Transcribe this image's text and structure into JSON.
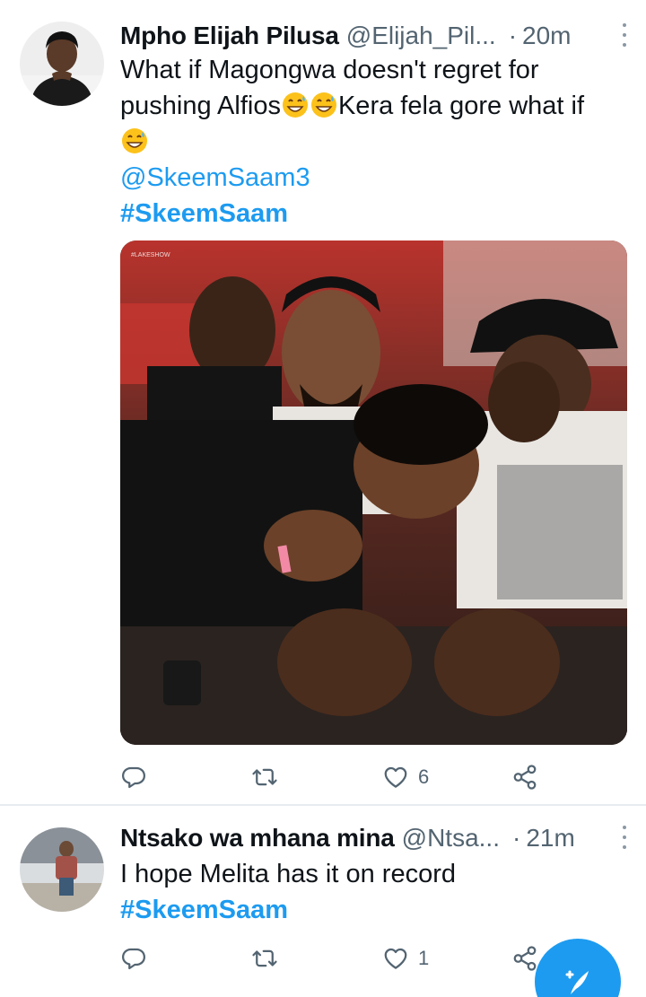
{
  "tweets": [
    {
      "author_name": "Mpho Elijah Pilusa",
      "handle": "@Elijah_Pil...",
      "separator": "·",
      "time": "20m",
      "text_line1": "What if Magongwa doesn't regret for",
      "text_line2_a": "pushing Alfios",
      "text_line2_b": "Kera fela gore what if",
      "mention": "@SkeemSaam3",
      "hashtag": "#SkeemSaam",
      "media_label": "#LAKESHOW",
      "likes": "6"
    },
    {
      "author_name": "Ntsako wa mhana mina",
      "handle": "@Ntsa...",
      "separator": "·",
      "time": "21m",
      "text": "I hope Melita has it on record",
      "hashtag": "#SkeemSaam",
      "likes": "1"
    }
  ],
  "icons": {
    "reply": "reply-icon",
    "retweet": "retweet-icon",
    "like": "heart-icon",
    "share": "share-icon",
    "more": "more-options-icon",
    "compose": "compose-tweet-icon"
  },
  "colors": {
    "accent": "#1d9bf0",
    "text": "#0f1419",
    "muted": "#536471"
  }
}
